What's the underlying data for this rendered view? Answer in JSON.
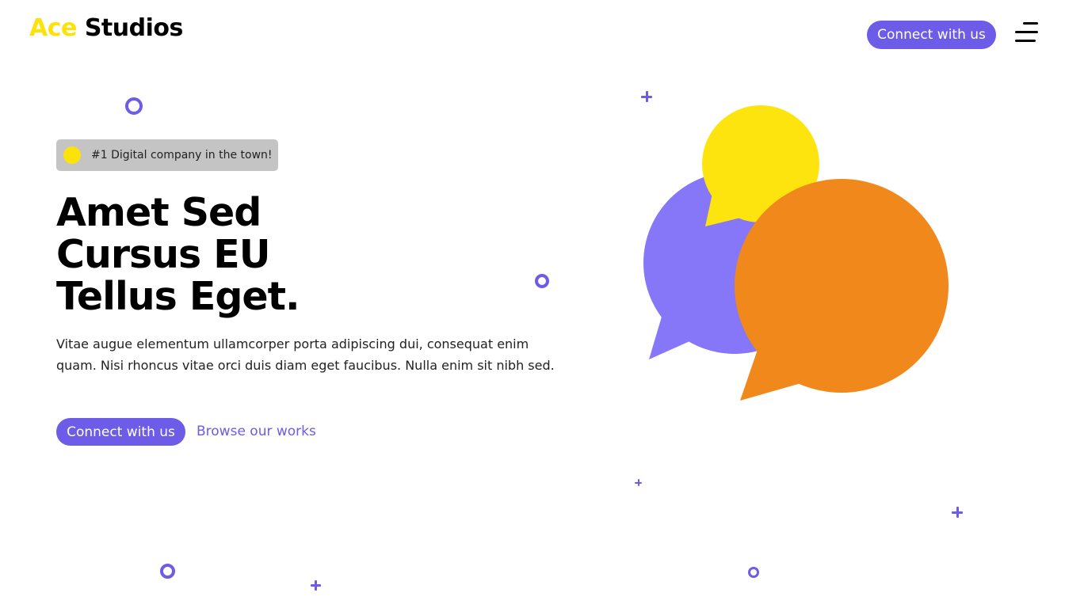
{
  "header": {
    "logo_accent": "Ace",
    "logo_rest": "Studios",
    "cta_label": "Connect with us",
    "menu_icon": "hamburger-menu-icon"
  },
  "hero": {
    "badge_text": "#1 Digital company in the town!",
    "title_lines": [
      "Amet Sed",
      "Cursus EU",
      "Tellus Eget."
    ],
    "description": "Vitae augue elementum ullamcorper porta adipiscing dui, consequat enim quam. Nisi rhoncus vitae orci duis diam eget faucibus. Nulla enim sit nibh sed.",
    "primary_cta": "Connect with us",
    "secondary_link": "Browse our works"
  },
  "illustration": {
    "icon": "chat-bubbles-icon",
    "colors": {
      "purple_bubble": "#8577f7",
      "yellow_bubble": "#fde40f",
      "orange_bubble": "#f0881c"
    }
  },
  "colors": {
    "accent": "#6c5ce7",
    "logo_accent": "#fde20a",
    "badge_bg": "#c4c4c4"
  }
}
